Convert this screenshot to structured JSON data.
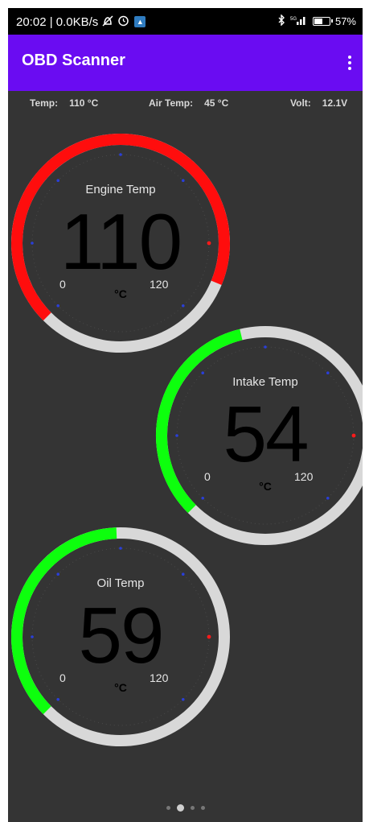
{
  "status_bar": {
    "time_speed": "20:02 | 0.0KB/s",
    "icons_left": [
      "do-not-disturb-icon",
      "alarm-icon",
      "app-notification-icon"
    ],
    "icons_right": [
      "bluetooth-icon",
      "5g-signal-icon",
      "battery-icon"
    ],
    "network": "5G",
    "battery_percent": "57%",
    "battery_level": 0.57
  },
  "app_bar": {
    "title": "OBD Scanner",
    "menu_icon": "more-vert-icon"
  },
  "info_bar": {
    "temp_label": "Temp:",
    "temp_value": "110 °C",
    "air_label": "Air Temp:",
    "air_value": "45 °C",
    "volt_label": "Volt:",
    "volt_value": "12.1V"
  },
  "gauges": [
    {
      "label": "Engine Temp",
      "value": "110",
      "numeric": 110,
      "min": "0",
      "max": "120",
      "min_num": 0,
      "max_num": 120,
      "unit": "°C",
      "color": "#ff0d0d"
    },
    {
      "label": "Intake Temp",
      "value": "54",
      "numeric": 54,
      "min": "0",
      "max": "120",
      "min_num": 0,
      "max_num": 120,
      "unit": "°C",
      "color": "#0dff0d"
    },
    {
      "label": "Oil Temp",
      "value": "59",
      "numeric": 59,
      "min": "0",
      "max": "120",
      "min_num": 0,
      "max_num": 120,
      "unit": "°C",
      "color": "#0dff0d"
    }
  ],
  "colors": {
    "app_bar": "#6a0cf2",
    "background": "#343434",
    "track": "#d8d8d8"
  },
  "pager": {
    "pages": 4,
    "active": 1
  }
}
